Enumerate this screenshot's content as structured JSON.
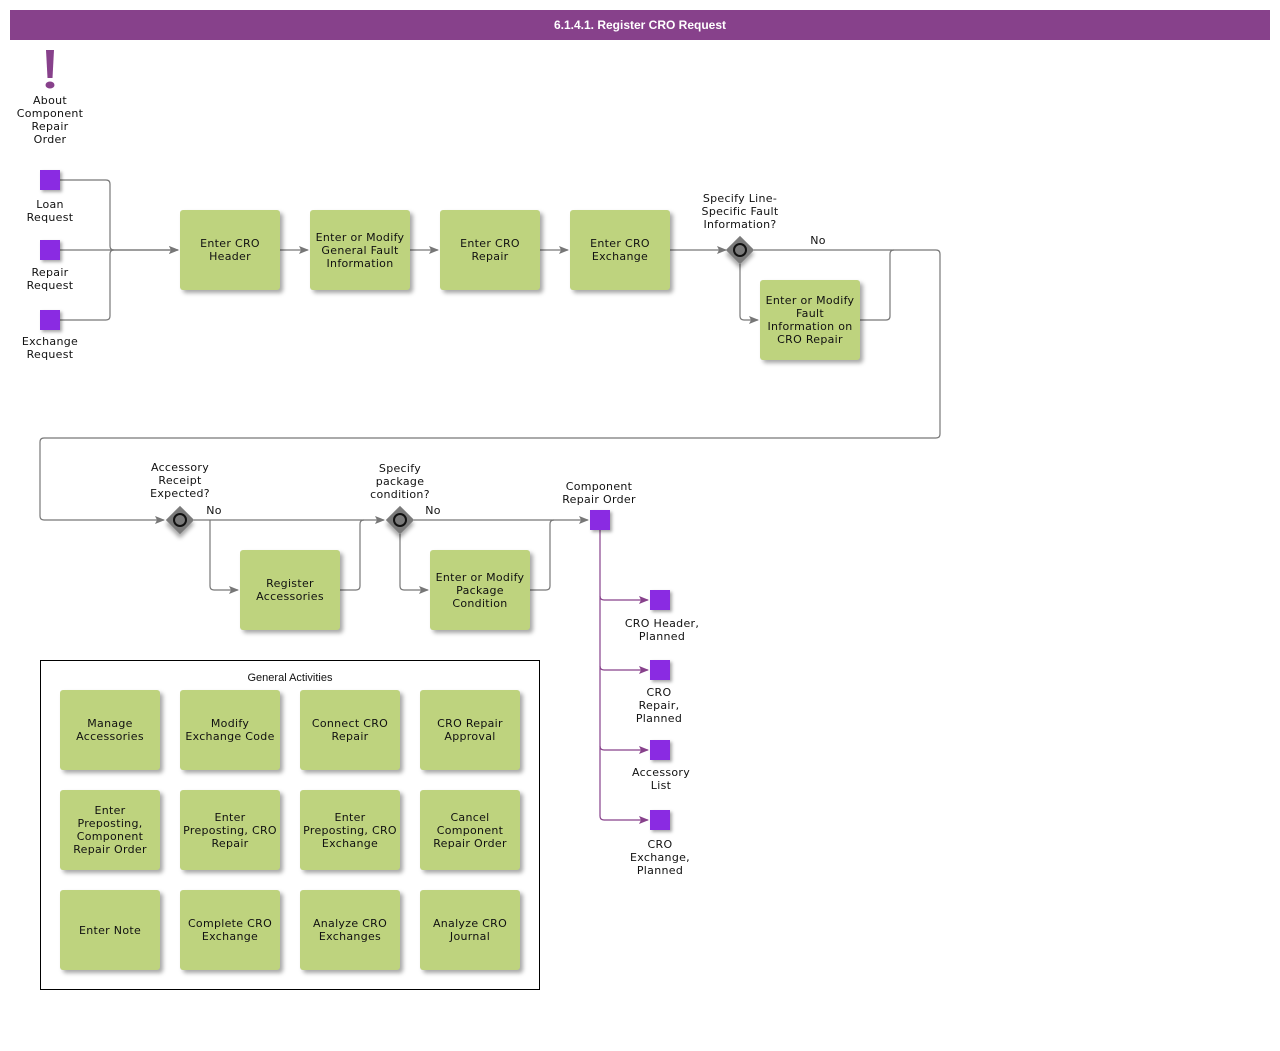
{
  "title": "6.1.4.1. Register CRO Request",
  "colors": {
    "title_bar": "#87418b",
    "task_fill": "#bed37e",
    "data_object": "#8a2be2",
    "flow_line": "#777777",
    "output_flow_line": "#87418b",
    "gateway": "#7a7a7a"
  },
  "about": {
    "icon": "exclamation-icon",
    "label": "About\nComponent\nRepair\nOrder"
  },
  "inputs": [
    {
      "label": "Loan\nRequest"
    },
    {
      "label": "Repair\nRequest"
    },
    {
      "label": "Exchange\nRequest"
    }
  ],
  "tasks": {
    "enter_cro_header": "Enter CRO Header",
    "enter_general_fault": "Enter or Modify General Fault Information",
    "enter_cro_repair": "Enter CRO Repair",
    "enter_cro_exchange": "Enter CRO Exchange",
    "enter_fault_on_repair": "Enter or Modify Fault Information on CRO Repair",
    "register_accessories": "Register Accessories",
    "enter_package_condition": "Enter or Modify Package Condition"
  },
  "gateways": {
    "line_specific_fault": {
      "question": "Specify Line-\nSpecific Fault\nInformation?",
      "no_label": "No"
    },
    "accessory_receipt": {
      "question": "Accessory\nReceipt\nExpected?",
      "no_label": "No"
    },
    "package_condition": {
      "question": "Specify\npackage\ncondition?",
      "no_label": "No"
    }
  },
  "result": {
    "label": "Component\nRepair Order"
  },
  "outputs": [
    {
      "label": "CRO Header,\nPlanned"
    },
    {
      "label": "CRO\nRepair,\nPlanned"
    },
    {
      "label": "Accessory\nList"
    },
    {
      "label": "CRO\nExchange,\nPlanned"
    }
  ],
  "general_activities": {
    "title": "General Activities",
    "items": [
      "Manage Accessories",
      "Modify Exchange Code",
      "Connect CRO Repair",
      "CRO Repair Approval",
      "Enter Preposting, Component Repair Order",
      "Enter Preposting, CRO Repair",
      "Enter Preposting, CRO Exchange",
      "Cancel Component Repair Order",
      "Enter Note",
      "Complete CRO Exchange",
      "Analyze CRO Exchanges",
      "Analyze CRO Journal"
    ]
  }
}
